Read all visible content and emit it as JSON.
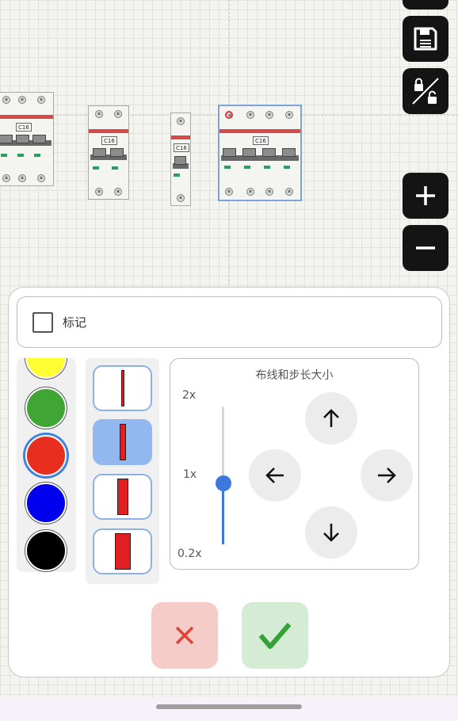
{
  "canvas": {
    "breakers": [
      {
        "rating": "C16",
        "poles": 3
      },
      {
        "rating": "C16",
        "poles": 2
      },
      {
        "rating": "C16",
        "poles": 1
      },
      {
        "rating": "C16",
        "poles": 4,
        "selected": true
      }
    ]
  },
  "toolbar": {
    "icons": [
      "save-icon",
      "save-icon",
      "lock-unlock-icon",
      "zoom-in-icon",
      "zoom-out-icon"
    ]
  },
  "panel": {
    "mark_label": "标记",
    "mark_checked": false,
    "colors": [
      {
        "name": "yellow",
        "hex": "#ffff33"
      },
      {
        "name": "green",
        "hex": "#3fa535"
      },
      {
        "name": "red",
        "hex": "#e82e1e",
        "selected": true
      },
      {
        "name": "blue",
        "hex": "#0000ee"
      },
      {
        "name": "black",
        "hex": "#000000"
      }
    ],
    "wire_widths": [
      {
        "level": 1
      },
      {
        "level": 2,
        "selected": true
      },
      {
        "level": 3
      },
      {
        "level": 4
      }
    ],
    "wiring": {
      "title": "布线和步长大小",
      "scale_max": "2x",
      "scale_mid": "1x",
      "scale_min": "0.2x",
      "scale_value": 1
    },
    "accent_color": "#3d78dc"
  }
}
